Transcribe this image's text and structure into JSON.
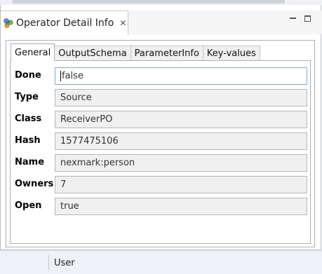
{
  "view": {
    "title": "Operator Detail Info",
    "icon": "operator-icon",
    "close_icon": "close-icon",
    "controls": [
      "minimize-icon",
      "maximize-icon"
    ]
  },
  "tabs": [
    {
      "label": "General",
      "active": true
    },
    {
      "label": "OutputSchema",
      "active": false
    },
    {
      "label": "ParameterInfo",
      "active": false
    },
    {
      "label": "Key-values",
      "active": false
    }
  ],
  "fields": [
    {
      "label": "Done",
      "value": "false",
      "focused": true
    },
    {
      "label": "Type",
      "value": "Source"
    },
    {
      "label": "Class",
      "value": "ReceiverPO"
    },
    {
      "label": "Hash",
      "value": "1577475106"
    },
    {
      "label": "Name",
      "value": "nexmark:person"
    },
    {
      "label": "Owners",
      "value": "7"
    },
    {
      "label": "Open",
      "value": "true"
    }
  ],
  "statusbar": {
    "text": "User"
  }
}
